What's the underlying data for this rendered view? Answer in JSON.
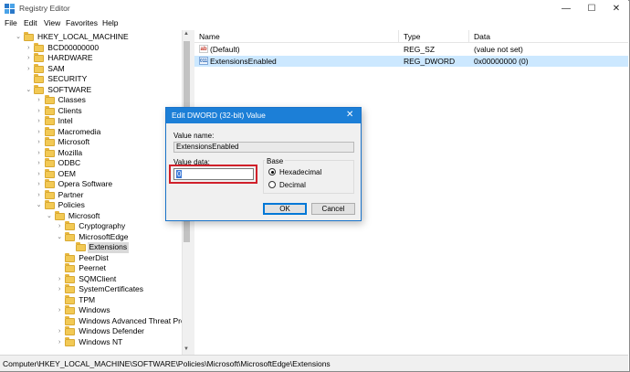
{
  "window": {
    "title": "Registry Editor",
    "controls": {
      "minimize": "—",
      "maximize": "☐",
      "close": "✕"
    }
  },
  "menu": [
    "File",
    "Edit",
    "View",
    "Favorites",
    "Help"
  ],
  "tree": [
    {
      "label": "HKEY_LOCAL_MACHINE",
      "level": 1,
      "expanded": true
    },
    {
      "label": "BCD00000000",
      "level": 2,
      "expanded": false
    },
    {
      "label": "HARDWARE",
      "level": 2,
      "expanded": false
    },
    {
      "label": "SAM",
      "level": 2,
      "expanded": false
    },
    {
      "label": "SECURITY",
      "level": 2,
      "expanded": null
    },
    {
      "label": "SOFTWARE",
      "level": 2,
      "expanded": true
    },
    {
      "label": "Classes",
      "level": 3,
      "expanded": false
    },
    {
      "label": "Clients",
      "level": 3,
      "expanded": false
    },
    {
      "label": "Intel",
      "level": 3,
      "expanded": false
    },
    {
      "label": "Macromedia",
      "level": 3,
      "expanded": false
    },
    {
      "label": "Microsoft",
      "level": 3,
      "expanded": false
    },
    {
      "label": "Mozilla",
      "level": 3,
      "expanded": false
    },
    {
      "label": "ODBC",
      "level": 3,
      "expanded": false
    },
    {
      "label": "OEM",
      "level": 3,
      "expanded": false
    },
    {
      "label": "Opera Software",
      "level": 3,
      "expanded": false
    },
    {
      "label": "Partner",
      "level": 3,
      "expanded": false
    },
    {
      "label": "Policies",
      "level": 3,
      "expanded": true
    },
    {
      "label": "Microsoft",
      "level": 4,
      "expanded": true
    },
    {
      "label": "Cryptography",
      "level": 5,
      "expanded": false
    },
    {
      "label": "MicrosoftEdge",
      "level": 5,
      "expanded": true
    },
    {
      "label": "Extensions",
      "level": 6,
      "expanded": null,
      "selected": true
    },
    {
      "label": "PeerDist",
      "level": 5,
      "expanded": null
    },
    {
      "label": "Peernet",
      "level": 5,
      "expanded": null
    },
    {
      "label": "SQMClient",
      "level": 5,
      "expanded": false
    },
    {
      "label": "SystemCertificates",
      "level": 5,
      "expanded": false
    },
    {
      "label": "TPM",
      "level": 5,
      "expanded": null
    },
    {
      "label": "Windows",
      "level": 5,
      "expanded": false
    },
    {
      "label": "Windows Advanced Threat Prot",
      "level": 5,
      "expanded": null
    },
    {
      "label": "Windows Defender",
      "level": 5,
      "expanded": false
    },
    {
      "label": "Windows NT",
      "level": 5,
      "expanded": false
    }
  ],
  "list": {
    "columns": [
      "Name",
      "Type",
      "Data"
    ],
    "rows": [
      {
        "icon": "string-value-icon",
        "icon_text": "ab",
        "name": "(Default)",
        "type": "REG_SZ",
        "data": "(value not set)",
        "selected": false
      },
      {
        "icon": "dword-value-icon",
        "icon_text": "011",
        "name": "ExtensionsEnabled",
        "type": "REG_DWORD",
        "data": "0x00000000 (0)",
        "selected": true
      }
    ]
  },
  "status": {
    "path": "Computer\\HKEY_LOCAL_MACHINE\\SOFTWARE\\Policies\\Microsoft\\MicrosoftEdge\\Extensions"
  },
  "dialog": {
    "title": "Edit DWORD (32-bit) Value",
    "close": "✕",
    "value_name_label": "Value name:",
    "value_name": "ExtensionsEnabled",
    "value_data_label": "Value data:",
    "value_data": "0",
    "base_label": "Base",
    "hex_label": "Hexadecimal",
    "dec_label": "Decimal",
    "base_selected": "Hexadecimal",
    "ok_label": "OK",
    "cancel_label": "Cancel"
  },
  "colors": {
    "accent": "#1c7fd7",
    "selection": "#cce8ff",
    "highlight_outline": "#d0202a",
    "folder": "#f2c955"
  }
}
